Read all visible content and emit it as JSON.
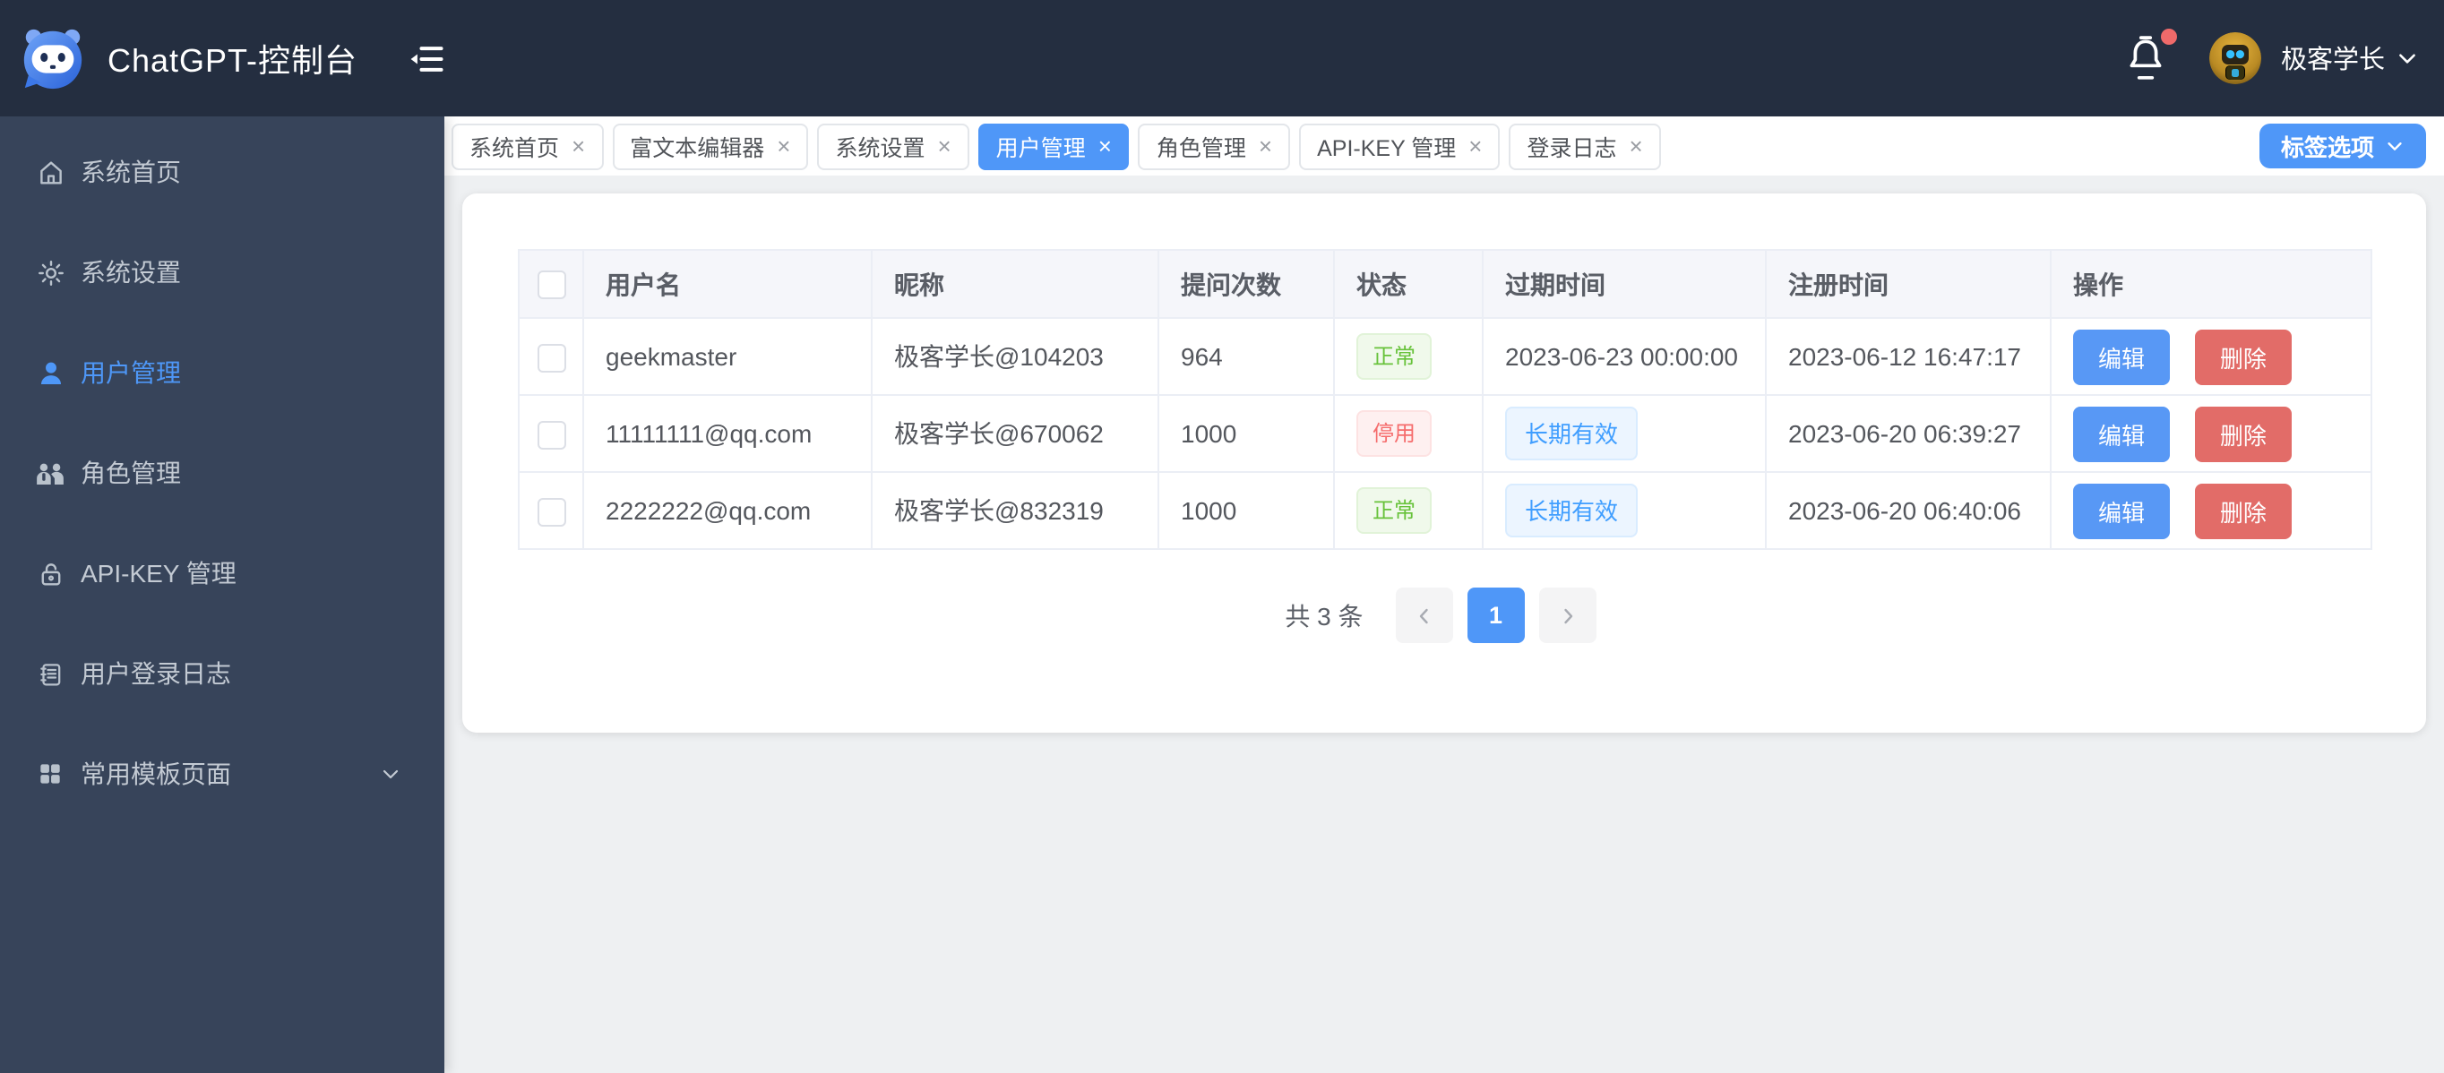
{
  "topbar": {
    "title": "ChatGPT-控制台",
    "username": "极客学长"
  },
  "sidebar": {
    "items": [
      {
        "label": "系统首页",
        "icon": "home-icon"
      },
      {
        "label": "系统设置",
        "icon": "gear-icon"
      },
      {
        "label": "用户管理",
        "icon": "user-icon"
      },
      {
        "label": "角色管理",
        "icon": "team-icon"
      },
      {
        "label": "API-KEY 管理",
        "icon": "lock-icon"
      },
      {
        "label": "用户登录日志",
        "icon": "journal-icon"
      },
      {
        "label": "常用模板页面",
        "icon": "grid-icon"
      }
    ],
    "active_label": "用户管理"
  },
  "tabs": {
    "items": [
      {
        "label": "系统首页"
      },
      {
        "label": "富文本编辑器"
      },
      {
        "label": "系统设置"
      },
      {
        "label": "用户管理"
      },
      {
        "label": "角色管理"
      },
      {
        "label": "API-KEY 管理"
      },
      {
        "label": "登录日志"
      }
    ],
    "active_label": "用户管理",
    "close_glyph": "×",
    "options_button": "标签选项"
  },
  "table": {
    "headers": {
      "username": "用户名",
      "nickname": "昵称",
      "question_count": "提问次数",
      "status": "状态",
      "expire_time": "过期时间",
      "register_time": "注册时间",
      "actions": "操作"
    },
    "rows": [
      {
        "username": "geekmaster",
        "nickname": "极客学长@104203",
        "question_count": "964",
        "status": "正常",
        "status_type": "success",
        "expire": "2023-06-23 00:00:00",
        "expire_type": "text",
        "register_time": "2023-06-12 16:47:17",
        "edit_label": "编辑",
        "delete_label": "删除"
      },
      {
        "username": "11111111@qq.com",
        "nickname": "极客学长@670062",
        "question_count": "1000",
        "status": "停用",
        "status_type": "danger",
        "expire": "长期有效",
        "expire_type": "tag",
        "register_time": "2023-06-20 06:39:27",
        "edit_label": "编辑",
        "delete_label": "删除"
      },
      {
        "username": "2222222@qq.com",
        "nickname": "极客学长@832319",
        "question_count": "1000",
        "status": "正常",
        "status_type": "success",
        "expire": "长期有效",
        "expire_type": "tag",
        "register_time": "2023-06-20 06:40:06",
        "edit_label": "编辑",
        "delete_label": "删除"
      }
    ]
  },
  "pagination": {
    "total_label": "共 3 条",
    "current_page": "1"
  },
  "colors": {
    "topbar_bg": "#242e40",
    "sidebar_bg": "#37445a",
    "accent_blue": "#4f97f8",
    "edit_blue": "#5898f5",
    "delete_red": "#e26c68",
    "success_green": "#67c23a",
    "danger_red": "#f56c6c",
    "tag_blue": "#409eff",
    "content_bg": "#eef0f2"
  }
}
